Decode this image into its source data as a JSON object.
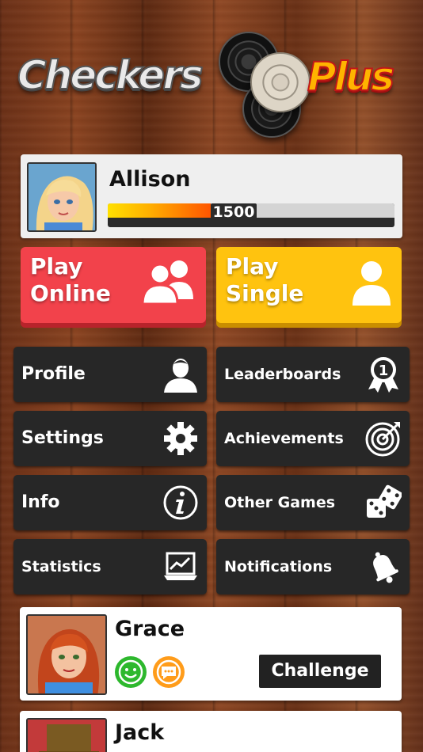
{
  "logo": {
    "text_left": "Checkers",
    "text_right": "Plus"
  },
  "player": {
    "name": "Allison",
    "rating": "1500",
    "rating_progress_percent": 36,
    "avatar_icon": "avatar-allison"
  },
  "play_buttons": [
    {
      "label": "Play Online",
      "line1": "Play",
      "line2": "Online",
      "icon": "two-users-icon",
      "color": "#f2424b"
    },
    {
      "label": "Play Single",
      "line1": "Play",
      "line2": "Single",
      "icon": "single-user-icon",
      "color": "#ffc30f"
    }
  ],
  "menu": {
    "profile": "Profile",
    "leaderboards": "Leaderboards",
    "settings": "Settings",
    "achievements": "Achievements",
    "info": "Info",
    "other_games": "Other Games",
    "statistics": "Statistics",
    "notifications": "Notifications"
  },
  "leaderboard_badge": "1",
  "friends": [
    {
      "name": "Grace",
      "action": "Challenge",
      "status_icons": [
        "smiley-icon",
        "chat-icon"
      ]
    },
    {
      "name": "Jack"
    }
  ],
  "colors": {
    "online_red": "#f2424b",
    "single_yellow": "#ffc30f",
    "menu_dark": "#272727",
    "status_green": "#2db82d",
    "status_orange": "#ff9c1a"
  }
}
